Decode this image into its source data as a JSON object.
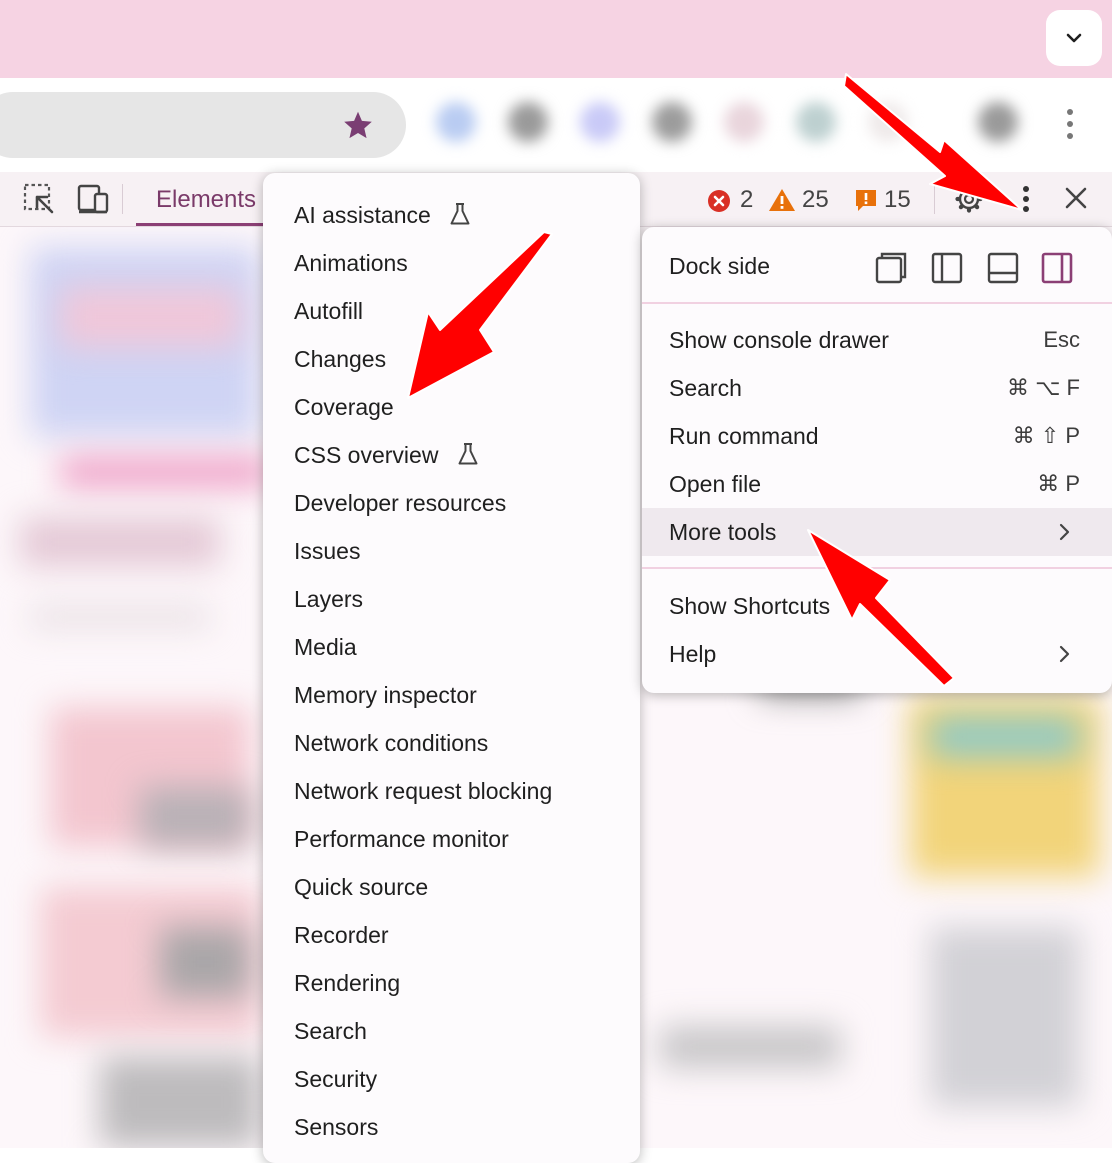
{
  "devtools": {
    "tabs": {
      "elements": "Elements"
    },
    "counts": {
      "errors": "2",
      "warnings": "25",
      "issues": "15"
    }
  },
  "more_tools_menu": {
    "items": [
      {
        "label": "AI assistance",
        "experimental": true
      },
      {
        "label": "Animations"
      },
      {
        "label": "Autofill"
      },
      {
        "label": "Changes"
      },
      {
        "label": "Coverage"
      },
      {
        "label": "CSS overview",
        "experimental": true
      },
      {
        "label": "Developer resources"
      },
      {
        "label": "Issues"
      },
      {
        "label": "Layers"
      },
      {
        "label": "Media"
      },
      {
        "label": "Memory inspector"
      },
      {
        "label": "Network conditions"
      },
      {
        "label": "Network request blocking"
      },
      {
        "label": "Performance monitor"
      },
      {
        "label": "Quick source"
      },
      {
        "label": "Recorder"
      },
      {
        "label": "Rendering"
      },
      {
        "label": "Search"
      },
      {
        "label": "Security"
      },
      {
        "label": "Sensors"
      }
    ]
  },
  "main_menu": {
    "dock_side_label": "Dock side",
    "items": [
      {
        "label": "Show console drawer",
        "shortcut": "Esc"
      },
      {
        "label": "Search",
        "shortcut": "⌘ ⌥ F"
      },
      {
        "label": "Run command",
        "shortcut": "⌘ ⇧ P"
      },
      {
        "label": "Open file",
        "shortcut": "⌘ P"
      },
      {
        "label": "More tools",
        "submenu": true,
        "highlighted": true
      },
      {
        "label": "Show Shortcuts"
      },
      {
        "label": "Help",
        "submenu": true
      }
    ]
  },
  "colors": {
    "title_bar": "#f6d3e3",
    "accent": "#8b3f75",
    "highlight_row": "#efe9ee",
    "annotation_arrow": "#ff0000",
    "error": "#d93025",
    "warning": "#e8710a"
  }
}
